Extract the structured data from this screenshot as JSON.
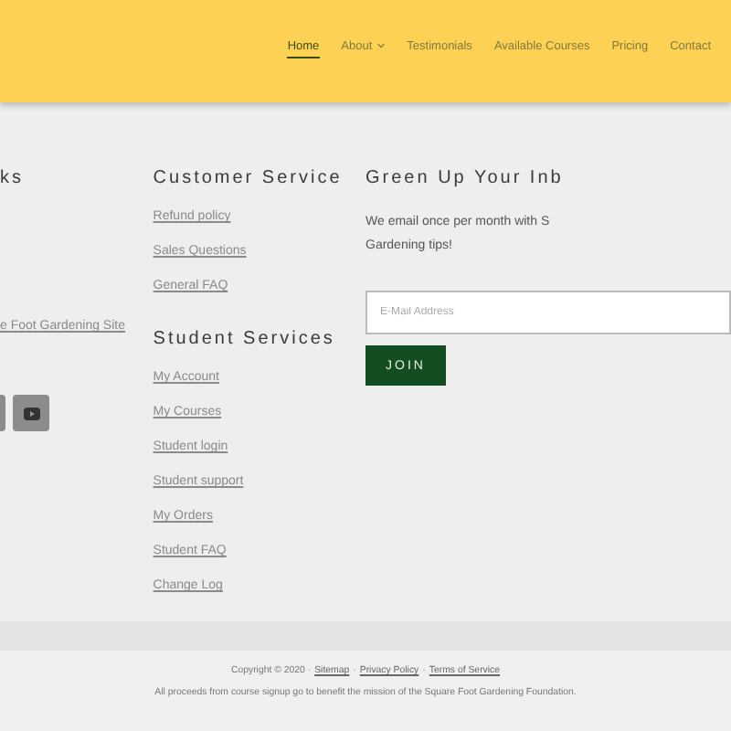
{
  "nav": {
    "items": [
      {
        "label": "Home",
        "selected": true,
        "has_menu": false
      },
      {
        "label": "About",
        "selected": false,
        "has_menu": true
      },
      {
        "label": "Testimonials",
        "selected": false,
        "has_menu": false
      },
      {
        "label": "Available Courses",
        "selected": false,
        "has_menu": false
      },
      {
        "label": "Pricing",
        "selected": false,
        "has_menu": false
      },
      {
        "label": "Contact",
        "selected": false,
        "has_menu": false
      }
    ]
  },
  "footer": {
    "links_column": {
      "heading": "ks",
      "links": [
        "e Foot Gardening Site"
      ],
      "social": [
        {
          "kind": "partial"
        },
        {
          "kind": "youtube"
        }
      ]
    },
    "customer_service": {
      "heading": "Customer Service",
      "links": [
        "Refund policy",
        "Sales Questions",
        "General FAQ"
      ]
    },
    "student_services": {
      "heading": "Student Services",
      "links": [
        "My Account",
        "My Courses",
        "Student login",
        "Student support",
        "My Orders",
        "Student FAQ",
        "Change Log"
      ]
    },
    "newsletter": {
      "heading": "Green Up Your Inb",
      "text": "We email once per month with S Gardening tips!",
      "email_placeholder": "E-Mail Address",
      "button": "JOIN"
    }
  },
  "bottom": {
    "copyright": "Copyright © 2020 ·",
    "links": [
      "Sitemap",
      "Privacy Policy",
      "Terms of Service"
    ],
    "separator": "·",
    "note": "All proceeds from course signup go to benefit the mission of the Square Foot Gardening Foundation."
  }
}
